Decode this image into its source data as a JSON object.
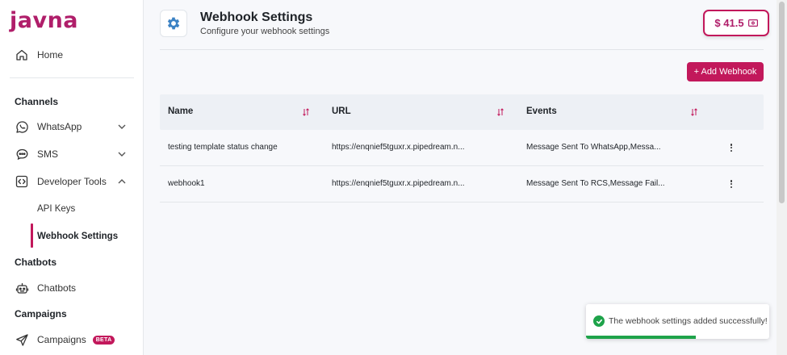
{
  "brand": {
    "logo_text": "javna",
    "accent": "#c2185b"
  },
  "sidebar": {
    "home": {
      "label": "Home",
      "icon": "home-icon"
    },
    "sections": {
      "channels": "Channels",
      "chatbots": "Chatbots",
      "campaigns": "Campaigns"
    },
    "items": {
      "whatsapp": {
        "label": "WhatsApp",
        "icon": "whatsapp-icon"
      },
      "sms": {
        "label": "SMS",
        "icon": "sms-icon"
      },
      "developer_tools": {
        "label": "Developer Tools",
        "icon": "code-icon"
      },
      "api_keys": {
        "label": "API Keys"
      },
      "webhook_settings": {
        "label": "Webhook Settings"
      },
      "chatbots": {
        "label": "Chatbots",
        "icon": "bot-icon"
      },
      "campaigns": {
        "label": "Campaigns",
        "icon": "send-icon",
        "badge": "BETA"
      }
    }
  },
  "header": {
    "title": "Webhook Settings",
    "subtitle": "Configure your webhook settings",
    "icon": "gear-icon",
    "balance": "$ 41.5"
  },
  "actions": {
    "add_webhook": "+ Add Webhook"
  },
  "table": {
    "columns": [
      "Name",
      "URL",
      "Events"
    ],
    "rows": [
      {
        "name": "testing template status change",
        "url": "https://enqnief5tguxr.x.pipedream.n...",
        "events": "Message Sent To WhatsApp,Messa..."
      },
      {
        "name": "webhook1",
        "url": "https://enqnief5tguxr.x.pipedream.n...",
        "events": "Message Sent To RCS,Message Fail..."
      }
    ]
  },
  "toast": {
    "message": "The webhook settings added successfully!",
    "progress": 0.6,
    "color": "#1ea34a"
  }
}
